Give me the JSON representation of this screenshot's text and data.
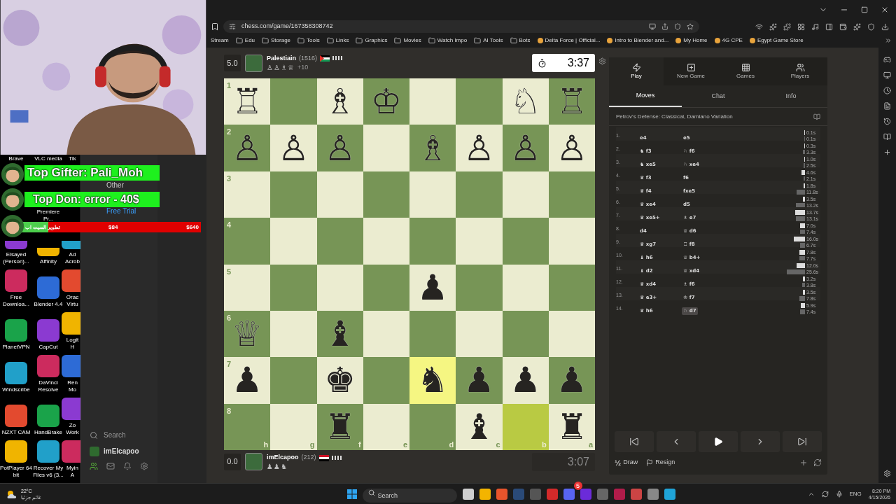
{
  "overlay": {
    "top_gifter": "Top Gifter: Pali_Moh",
    "top_donor": "Top Don: error - 40$",
    "goal": {
      "label": "تطوير السيت اب",
      "current": "$84",
      "target": "$640",
      "level": 0.15
    }
  },
  "desktop": {
    "top_labels": [
      "Brave",
      "VLC media",
      "Tik"
    ],
    "rows": [
      [
        null,
        {
          "label": "Premiere Pr...",
          "kind": "label_only"
        },
        null
      ],
      [
        {
          "label": "Elsayed (Person)...",
          "kind": "stub"
        },
        {
          "label": "Affinity",
          "kind": "stub"
        },
        {
          "label": "Ad Acrob",
          "kind": "stub"
        }
      ],
      [
        {
          "label": "Free Downloa...",
          "kind": "shortcut"
        },
        {
          "label": "Blender 4.4",
          "kind": "shortcut"
        },
        {
          "label": "Orac Virtu",
          "kind": "shortcut"
        }
      ],
      [
        {
          "label": "PlanetVPN",
          "kind": "shortcut"
        },
        {
          "label": "CapCut",
          "kind": "shortcut"
        },
        {
          "label": "Logit H",
          "kind": "shortcut"
        }
      ],
      [
        {
          "label": "Windscribe",
          "kind": "shortcut"
        },
        {
          "label": "DaVinci Resolve",
          "kind": "shortcut"
        },
        {
          "label": "Ren Mo",
          "kind": "shortcut"
        }
      ],
      [
        {
          "label": "NZXT CAM",
          "kind": "shortcut"
        },
        {
          "label": "HandBrake",
          "kind": "shortcut"
        },
        {
          "label": "Zo Work",
          "kind": "shortcut"
        }
      ],
      [
        {
          "label": "PotPlayer 64 bit",
          "kind": "shortcut"
        },
        {
          "label": "Recover My Files v6 (3...",
          "kind": "shortcut"
        },
        {
          "label": "Myin A",
          "kind": "shortcut"
        }
      ]
    ]
  },
  "side_panel": {
    "items": [
      {
        "label": "Other",
        "kind": "item"
      },
      {
        "label": "Free Trial",
        "kind": "link"
      }
    ],
    "search": {
      "placeholder": "Search"
    },
    "user": "imElcapoo"
  },
  "browser": {
    "url": "chess.com/game/167358308742",
    "bookmarks": [
      "Stream",
      "Edu",
      "Storage",
      "Tools",
      "Links",
      "Graphics",
      "Movies",
      "Watch Impo",
      "AI Tools",
      "Bots",
      "Delta Force | Official...",
      "Intro to Blender and...",
      "My Home",
      "4G CPE",
      "Egypt Game Store"
    ]
  },
  "top_player": {
    "score": "5.0",
    "name": "Palestiain",
    "rating": "(1516)",
    "captured": [
      "♙",
      "♙",
      "♗",
      "♕"
    ],
    "material": "+10",
    "clock": "3:37",
    "active": true
  },
  "bottom_player": {
    "score": "0.0",
    "name": "imElcapoo",
    "rating": "(212)",
    "captured": [
      "♟",
      "♟",
      "♞"
    ],
    "clock": "3:07",
    "active": false
  },
  "board": {
    "files": [
      "h",
      "g",
      "f",
      "e",
      "d",
      "c",
      "b",
      "a"
    ],
    "rows": [
      {
        "rank": "1",
        "squares": [
          {
            "piece": "♖",
            "highlighted": false
          },
          {
            "highlighted": false
          },
          {
            "piece": "♗",
            "highlighted": false
          },
          {
            "piece": "♔",
            "highlighted": false
          },
          {
            "highlighted": false
          },
          {
            "highlighted": false
          },
          {
            "piece": "♘",
            "highlighted": false
          },
          {
            "piece": "♖",
            "highlighted": false
          }
        ]
      },
      {
        "rank": "2",
        "squares": [
          {
            "piece": "♙",
            "highlighted": false
          },
          {
            "piece": "♙",
            "highlighted": false
          },
          {
            "piece": "♙",
            "highlighted": false
          },
          {
            "highlighted": false
          },
          {
            "piece": "♗",
            "highlighted": false
          },
          {
            "piece": "♙",
            "highlighted": false
          },
          {
            "piece": "♙",
            "highlighted": false
          },
          {
            "piece": "♙",
            "highlighted": false
          }
        ]
      },
      {
        "rank": "3",
        "squares": [
          {
            "highlighted": false
          },
          {
            "highlighted": false
          },
          {
            "highlighted": false
          },
          {
            "highlighted": false
          },
          {
            "highlighted": false
          },
          {
            "highlighted": false
          },
          {
            "highlighted": false
          },
          {
            "highlighted": false
          }
        ]
      },
      {
        "rank": "4",
        "squares": [
          {
            "highlighted": false
          },
          {
            "highlighted": false
          },
          {
            "highlighted": false
          },
          {
            "highlighted": false
          },
          {
            "highlighted": false
          },
          {
            "highlighted": false
          },
          {
            "highlighted": false
          },
          {
            "highlighted": false
          }
        ]
      },
      {
        "rank": "5",
        "squares": [
          {
            "highlighted": false
          },
          {
            "highlighted": false
          },
          {
            "highlighted": false
          },
          {
            "highlighted": false
          },
          {
            "piece": "♟",
            "highlighted": false
          },
          {
            "highlighted": false
          },
          {
            "highlighted": false
          },
          {
            "highlighted": false
          }
        ]
      },
      {
        "rank": "6",
        "squares": [
          {
            "piece": "♕",
            "highlighted": false
          },
          {
            "highlighted": false
          },
          {
            "piece": "♝",
            "highlighted": false
          },
          {
            "highlighted": false
          },
          {
            "highlighted": false
          },
          {
            "highlighted": false
          },
          {
            "highlighted": false
          },
          {
            "highlighted": false
          }
        ]
      },
      {
        "rank": "7",
        "squares": [
          {
            "piece": "♟",
            "highlighted": false
          },
          {
            "highlighted": false
          },
          {
            "piece": "♚",
            "highlighted": false
          },
          {
            "highlighted": false
          },
          {
            "piece": "♞",
            "highlighted": true
          },
          {
            "piece": "♟",
            "highlighted": false
          },
          {
            "piece": "♟",
            "highlighted": false
          },
          {
            "piece": "♟",
            "highlighted": false
          }
        ]
      },
      {
        "rank": "8",
        "squares": [
          {
            "highlighted": false
          },
          {
            "highlighted": false
          },
          {
            "piece": "♜",
            "highlighted": false
          },
          {
            "highlighted": false
          },
          {
            "highlighted": false
          },
          {
            "piece": "♝",
            "highlighted": false
          },
          {
            "highlighted": true
          },
          {
            "piece": "♜",
            "highlighted": false
          }
        ]
      }
    ]
  },
  "nav_tabs": [
    {
      "label": "Play",
      "selected": true
    },
    {
      "label": "New Game",
      "selected": false
    },
    {
      "label": "Games",
      "selected": false
    },
    {
      "label": "Players",
      "selected": false
    }
  ],
  "panel_tabs": [
    {
      "label": "Moves",
      "selected": true
    },
    {
      "label": "Chat",
      "selected": false
    },
    {
      "label": "Info",
      "selected": false
    }
  ],
  "opening": "Petrov's Defense: Classical, Damiano Variation",
  "moves": [
    {
      "number": "1.",
      "white": {
        "san": "e4",
        "selected": false,
        "time": "0.1s"
      },
      "black": {
        "san": "e5",
        "selected": false,
        "time": "0.1s"
      }
    },
    {
      "number": "2.",
      "white": {
        "san": "♞ f3",
        "selected": false,
        "time": "0.3s"
      },
      "black": {
        "san": "♘ f6",
        "selected": false,
        "time": "3.3s"
      }
    },
    {
      "number": "3.",
      "white": {
        "san": "♞ xe5",
        "selected": false,
        "time": "1.0s"
      },
      "black": {
        "san": "♘ xe4",
        "selected": false,
        "time": "2.5s"
      }
    },
    {
      "number": "4.",
      "white": {
        "san": "♛ f3",
        "selected": false,
        "time": "4.6s"
      },
      "black": {
        "san": "f6",
        "selected": false,
        "time": "2.1s"
      }
    },
    {
      "number": "5.",
      "white": {
        "san": "♛ f4",
        "selected": false,
        "time": "1.8s"
      },
      "black": {
        "san": "fxe5",
        "selected": false,
        "time": "11.8s"
      }
    },
    {
      "number": "6.",
      "white": {
        "san": "♛ xe4",
        "selected": false,
        "time": "3.5s"
      },
      "black": {
        "san": "d5",
        "selected": false,
        "time": "13.2s"
      }
    },
    {
      "number": "7.",
      "white": {
        "san": "♛ xe5+",
        "selected": false,
        "time": "13.7s"
      },
      "black": {
        "san": "♗ e7",
        "selected": false,
        "time": "13.1s"
      }
    },
    {
      "number": "8.",
      "white": {
        "san": "d4",
        "selected": false,
        "time": "7.0s"
      },
      "black": {
        "san": "♕ d6",
        "selected": false,
        "time": "7.4s"
      }
    },
    {
      "number": "9.",
      "white": {
        "san": "♛ xg7",
        "selected": false,
        "time": "16.0s"
      },
      "black": {
        "san": "♖ f8",
        "selected": false,
        "time": "6.7s"
      }
    },
    {
      "number": "10.",
      "white": {
        "san": "♝ h6",
        "selected": false,
        "time": "7.8s"
      },
      "black": {
        "san": "♕ b4+",
        "selected": false,
        "time": "7.7s"
      }
    },
    {
      "number": "11.",
      "white": {
        "san": "♝ d2",
        "selected": false,
        "time": "12.0s"
      },
      "black": {
        "san": "♕ xd4",
        "selected": false,
        "time": "25.6s"
      }
    },
    {
      "number": "12.",
      "white": {
        "san": "♛ xd4",
        "selected": false,
        "time": "3.2s"
      },
      "black": {
        "san": "♗ f6",
        "selected": false,
        "time": "3.8s"
      }
    },
    {
      "number": "13.",
      "white": {
        "san": "♛ e3+",
        "selected": false,
        "time": "3.5s"
      },
      "black": {
        "san": "♔ f7",
        "selected": false,
        "time": "7.8s"
      }
    },
    {
      "number": "14.",
      "white": {
        "san": "♛ h6",
        "selected": false,
        "time": "5.9s"
      },
      "black": {
        "san": "♘ d7",
        "selected": true,
        "time": "7.4s"
      }
    }
  ],
  "actions": {
    "draw_symbol": "½",
    "draw": "Draw",
    "resign": "Resign"
  },
  "taskbar": {
    "search": {
      "placeholder": "Search"
    },
    "badge": "5",
    "temperature": "22°C",
    "weather": "غائم جزئيا",
    "language": "ENG",
    "time": "8:20 PM",
    "date": "4/15/2026"
  }
}
